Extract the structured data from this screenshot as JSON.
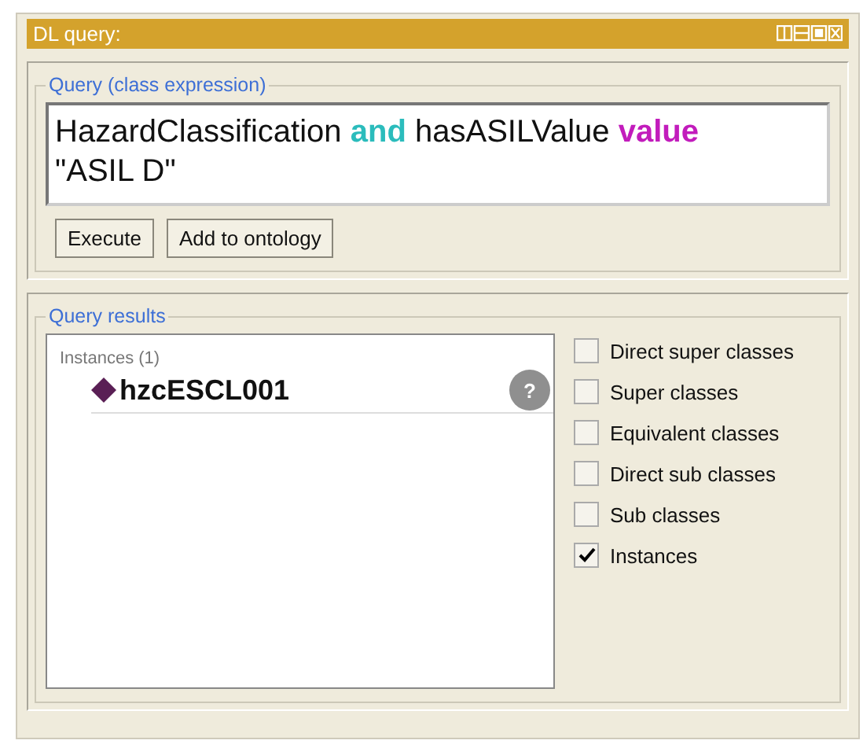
{
  "window": {
    "title": "DL query:"
  },
  "query": {
    "legend": "Query (class expression)",
    "segments": [
      {
        "text": "HazardClassification ",
        "kind": "plain"
      },
      {
        "text": "and",
        "kind": "keyword",
        "color": "#2bbcbc"
      },
      {
        "text": " hasASILValue ",
        "kind": "plain"
      },
      {
        "text": "value",
        "kind": "keyword",
        "color": "#c21cbc"
      },
      {
        "text": " \"ASIL D\"",
        "kind": "plain"
      }
    ],
    "buttons": [
      "Execute",
      "Add to ontology"
    ]
  },
  "results": {
    "legend": "Query results",
    "list_title": "Instances (1)",
    "items": [
      {
        "name": "hzcESCL001",
        "help": "?"
      }
    ],
    "options": [
      {
        "label": "Direct super classes",
        "checked": false
      },
      {
        "label": "Super classes",
        "checked": false
      },
      {
        "label": "Equivalent classes",
        "checked": false
      },
      {
        "label": "Direct sub classes",
        "checked": false
      },
      {
        "label": "Sub classes",
        "checked": false
      },
      {
        "label": "Instances",
        "checked": true
      }
    ]
  }
}
